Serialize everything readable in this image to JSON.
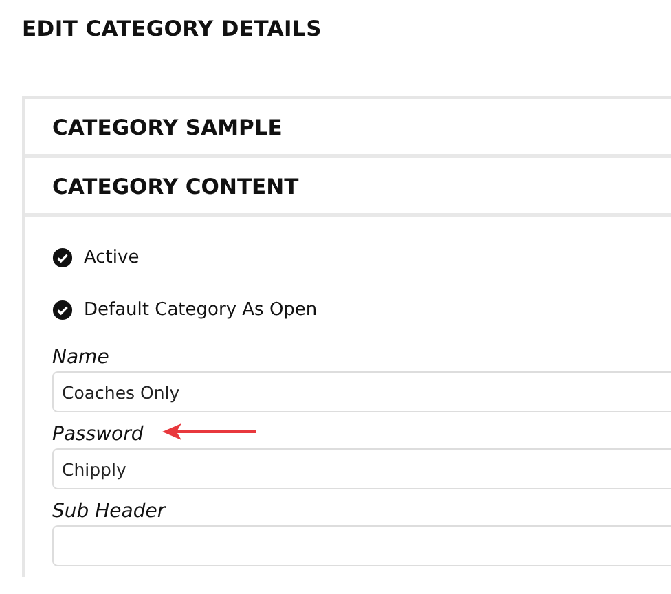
{
  "page_title": "EDIT CATEGORY DETAILS",
  "sections": [
    {
      "title": "CATEGORY SAMPLE"
    },
    {
      "title": "CATEGORY CONTENT"
    }
  ],
  "checkboxes": [
    {
      "label": "Active",
      "checked": true
    },
    {
      "label": "Default Category As Open",
      "checked": true
    }
  ],
  "fields": [
    {
      "label": "Name",
      "value": "Coaches Only",
      "highlighted": false
    },
    {
      "label": "Password",
      "value": "Chipply",
      "highlighted": true
    },
    {
      "label": "Sub Header",
      "highlighted": false
    }
  ]
}
